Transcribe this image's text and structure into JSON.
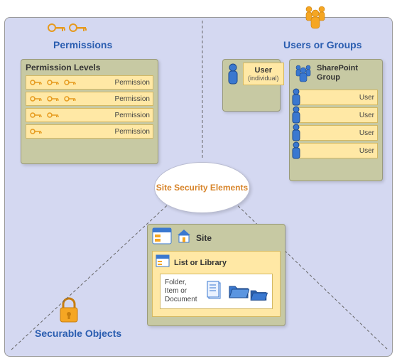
{
  "center": {
    "title": "Site Security Elements"
  },
  "sections": {
    "permissions": {
      "title": "Permissions",
      "box_title": "Permission Levels",
      "rows": [
        {
          "keys": 3,
          "label": "Permission"
        },
        {
          "keys": 3,
          "label": "Permission"
        },
        {
          "keys": 2,
          "label": "Permission"
        },
        {
          "keys": 1,
          "label": "Permission"
        }
      ]
    },
    "users_groups": {
      "title": "Users or Groups",
      "user_box": {
        "title": "User",
        "subtitle": "(individual)"
      },
      "sp_group": {
        "title": "SharePoint Group",
        "rows": [
          {
            "label": "User"
          },
          {
            "label": "User"
          },
          {
            "label": "User"
          },
          {
            "label": "User"
          }
        ]
      }
    },
    "securable": {
      "title": "Securable Objects",
      "site_box": {
        "title": "Site",
        "list_title": "List or Library",
        "folder_text": "Folder, Item or Document"
      }
    }
  },
  "icons": {
    "key": "key-icon",
    "user_single": "person-icon",
    "user_group": "people-group-icon",
    "lock": "lock-icon",
    "browser": "browser-icon",
    "house": "house-icon",
    "folder": "folder-icon",
    "document": "document-icon"
  },
  "colors": {
    "background": "#d4d8f1",
    "box": "#c7c9a3",
    "row": "#ffe8a5",
    "title": "#2a5db0",
    "center_text": "#d7842a",
    "orange": "#f5a623",
    "blue": "#3a78d0"
  }
}
